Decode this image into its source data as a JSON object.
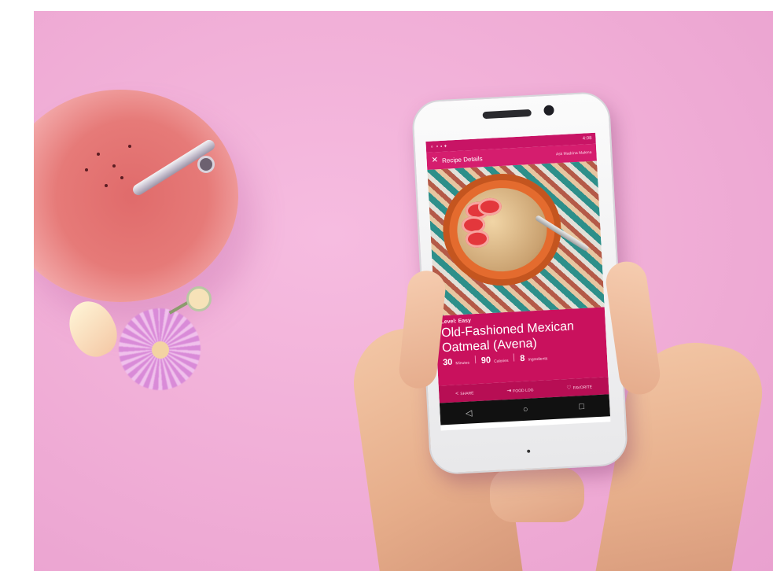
{
  "app": {
    "status_time": "4:08",
    "app_bar_title": "Recipe Details",
    "app_bar_right": "Ask Madrina Malena",
    "level": "Level: Easy",
    "recipe_title": "Old-Fashioned Mexican Oatmeal (Avena)",
    "stats": [
      {
        "value": "30",
        "unit": "Minutes"
      },
      {
        "value": "90",
        "unit": "Calories"
      },
      {
        "value": "8",
        "unit": "Ingredients"
      }
    ],
    "actions": [
      {
        "icon": "share-icon",
        "label": "SHARE"
      },
      {
        "icon": "food-log-icon",
        "label": "FOOD LOG"
      },
      {
        "icon": "heart-icon",
        "label": "FAVORITE"
      }
    ],
    "nav": [
      "back-icon",
      "home-icon",
      "recents-icon"
    ]
  },
  "colors": {
    "background": "#f0add6",
    "accent": "#c9115d",
    "app_bar": "#d51d6e"
  }
}
